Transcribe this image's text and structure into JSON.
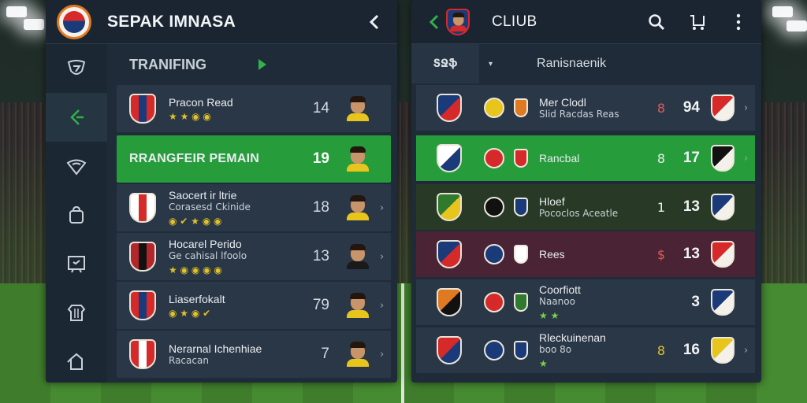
{
  "colors": {
    "accent_green": "#269c3b",
    "panel_bg": "#1f2b38",
    "row_bg": "#2a3746",
    "dark_green_row": "#283a25",
    "maroon_row": "#4a2434",
    "play_green": "#2fb24a"
  },
  "left": {
    "title": "SEPAK IMNASA",
    "back_icon": "chevron-left-icon",
    "sidebar_icons": [
      "shield-icon",
      "tactics-icon",
      "badge-icon",
      "bag-icon",
      "board-icon",
      "jersey-icon",
      "flag-icon"
    ],
    "subheader": "TRANIFING",
    "rows": [
      {
        "name": "Pracon Read",
        "sub": "",
        "icons": "★ ★ ◉ ◉",
        "number": "14",
        "style": "normal",
        "crest": [
          "#d62a2a",
          "#1b3a7a"
        ],
        "shirt": "#e7c51c",
        "chevron": ""
      },
      {
        "name": "RRANGFEIR PEMAIN",
        "sub": "",
        "icons": "",
        "number": "19",
        "style": "green",
        "crest": [],
        "shirt": "#e7c51c",
        "chevron": ""
      },
      {
        "name": "Saocert ir ltrie",
        "sub": "Corasesd Ckinide",
        "icons": "◉ ✔ ★ ◉ ◉",
        "number": "18",
        "style": "normal",
        "crest": [
          "#ffffff",
          "#d62a2a"
        ],
        "shirt": "#e7c51c",
        "chevron": "›"
      },
      {
        "name": "Hocarel Perido",
        "sub": "Ge cahisal lfoolo",
        "icons": "★ ◉ ◉ ◉ ◉",
        "number": "13",
        "style": "normal",
        "crest": [
          "#b3262b",
          "#111111"
        ],
        "shirt": "#1a1a1a",
        "chevron": "›"
      },
      {
        "name": "Liaserfokalt",
        "sub": "",
        "icons": "◉ ★ ◉ ✔",
        "number": "79",
        "style": "normal",
        "crest": [
          "#d62a2a",
          "#1b3a7a"
        ],
        "shirt": "#e7c51c",
        "chevron": "›"
      },
      {
        "name": "Nerarnal Ichenhiae",
        "sub": "Racacan",
        "icons": "",
        "number": "7",
        "style": "normal",
        "crest": [
          "#d62a2a",
          "#ffffff"
        ],
        "shirt": "#e7c51c",
        "chevron": "›"
      }
    ]
  },
  "right": {
    "title": "CLIUB",
    "back_icon": "chevron-left-icon",
    "search_icon": "search-icon",
    "cart_icon": "cart-icon",
    "menu_icon": "more-vertical-icon",
    "tab_label": "ՏՋֆ",
    "caret": "▾",
    "subheader": "Ranisnaenik",
    "rows": [
      {
        "name": "Mer Clodl",
        "sub": "Slid Racdas Reas",
        "icons": "",
        "stat": "8",
        "number": "94",
        "style": "normal",
        "chevron": "›"
      },
      {
        "name": "Rancbal",
        "sub": "",
        "icons": "",
        "stat": "8",
        "number": "17",
        "style": "green",
        "chevron": "›"
      },
      {
        "name": "Hloef",
        "sub": "Pococlos Aceatle",
        "icons": "",
        "stat": "1",
        "number": "13",
        "style": "darkgreen",
        "chevron": ""
      },
      {
        "name": "Rees",
        "sub": "",
        "icons": "",
        "stat": "$",
        "number": "13",
        "style": "maroon",
        "chevron": ""
      },
      {
        "name": "Coorfiott",
        "sub": "Naanoo",
        "icons": "★ ★",
        "stat": "",
        "number": "3",
        "style": "normal",
        "chevron": ""
      },
      {
        "name": "Rleckuinenan",
        "sub": "boo 8o",
        "icons": "★",
        "stat": "8",
        "number": "16",
        "style": "normal",
        "chevron": "›"
      }
    ]
  }
}
